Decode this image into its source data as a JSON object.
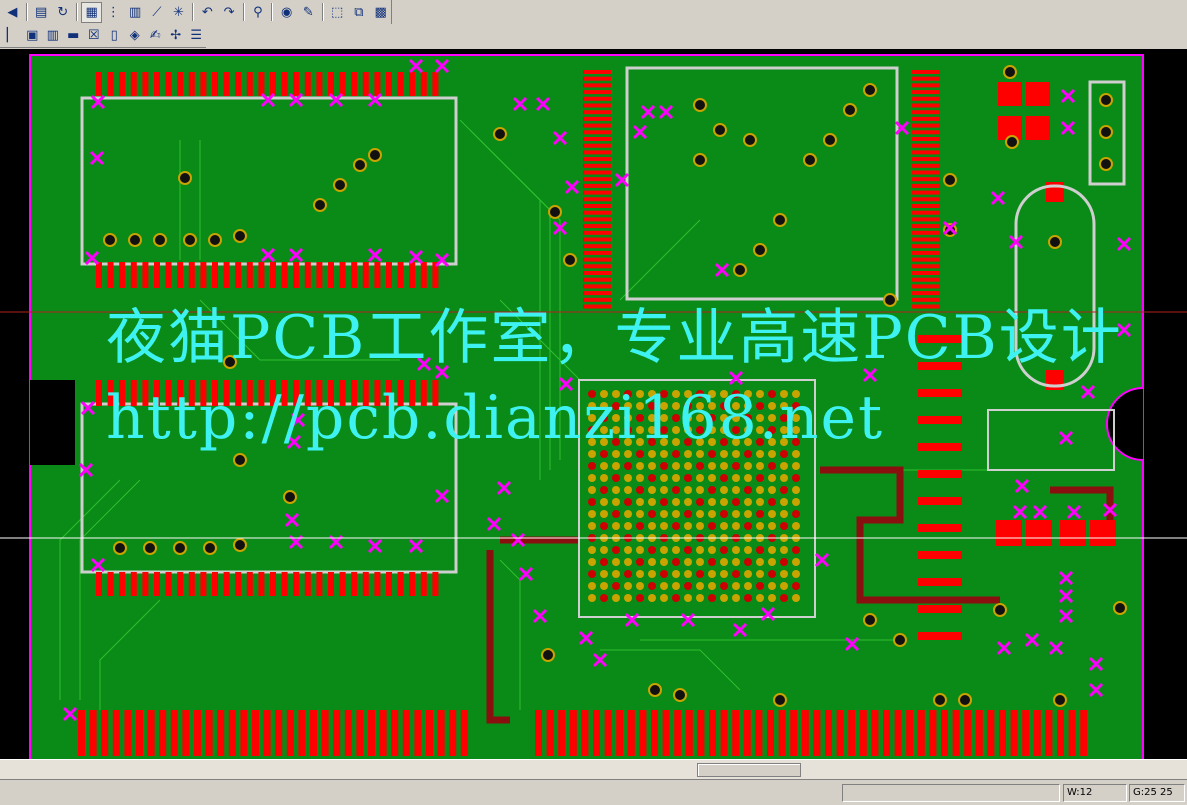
{
  "watermark": {
    "line1": "夜猫PCB工作室，专业高速PCB设计",
    "line2": "http://pcb.dianzi168.net"
  },
  "toolbar_top": [
    {
      "name": "collapse-icon",
      "glyph": "◀"
    },
    {
      "name": "properties-icon",
      "glyph": "▤"
    },
    {
      "name": "refresh-icon",
      "glyph": "↻"
    },
    {
      "name": "board-view-icon",
      "glyph": "▦"
    },
    {
      "name": "route-grid-icon",
      "glyph": "⋮"
    },
    {
      "name": "layer-icon",
      "glyph": "▥"
    },
    {
      "name": "line-tool-icon",
      "glyph": "⟋"
    },
    {
      "name": "star-tool-icon",
      "glyph": "✳"
    },
    {
      "name": "undo-icon",
      "glyph": "↶"
    },
    {
      "name": "redo-icon",
      "glyph": "↷"
    },
    {
      "name": "zoom-icon",
      "glyph": "⚲"
    },
    {
      "name": "view-area-icon",
      "glyph": "◉"
    },
    {
      "name": "brush-icon",
      "glyph": "✎"
    },
    {
      "name": "select-icon",
      "glyph": "⬚"
    },
    {
      "name": "window-icon",
      "glyph": "⧉"
    },
    {
      "name": "pattern-icon",
      "glyph": "▩"
    }
  ],
  "toolbar_bottom": [
    {
      "name": "panel-edge-icon",
      "glyph": "▏"
    },
    {
      "name": "component-icon",
      "glyph": "▣"
    },
    {
      "name": "library-icon",
      "glyph": "▥"
    },
    {
      "name": "drc-icon",
      "glyph": "▬"
    },
    {
      "name": "report-icon",
      "glyph": "☒"
    },
    {
      "name": "document-icon",
      "glyph": "▯"
    },
    {
      "name": "camera-icon",
      "glyph": "◈"
    },
    {
      "name": "text-icon",
      "glyph": "✍"
    },
    {
      "name": "router-icon",
      "glyph": "✢"
    },
    {
      "name": "list-icon",
      "glyph": "☰"
    }
  ],
  "status": {
    "width": "W:12",
    "grid": "G:25 25"
  },
  "colors": {
    "board": "#0a8a16",
    "pad": "#ff0000",
    "silk": "#cfcfcf",
    "marker": "#ff00ff",
    "watermark": "#3ff2f2"
  }
}
